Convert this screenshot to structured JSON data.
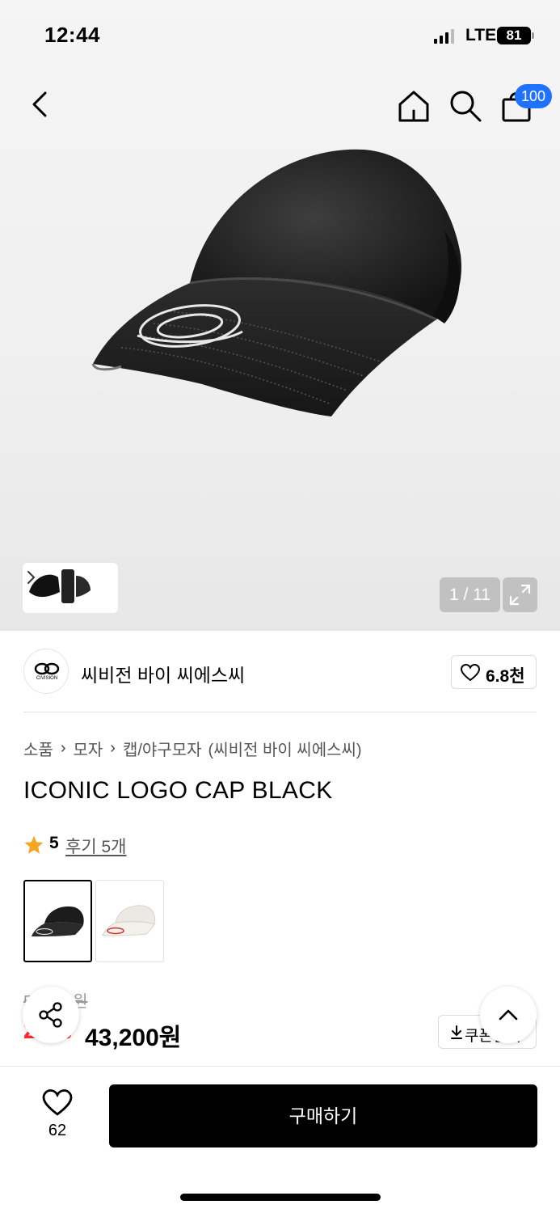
{
  "status_bar": {
    "time": "12:44",
    "network": "LTE",
    "battery": "81"
  },
  "nav": {
    "cart_badge": "100"
  },
  "gallery": {
    "page_counter": "1 / 11"
  },
  "brand": {
    "name": "씨비전 바이 씨에스씨",
    "logo_text": "CIVISION",
    "likes": "6.8천"
  },
  "breadcrumb": {
    "items": [
      "소품",
      "모자",
      "캡/야구모자"
    ],
    "brand": "(씨비전 바이 씨에스씨)"
  },
  "product": {
    "title": "ICONIC LOGO CAP BLACK",
    "rating": "5",
    "review_link": "후기 5개",
    "original_price": "54,000원",
    "discount": "20%",
    "sale_price": "43,200원",
    "coupon_label": "쿠폰받기"
  },
  "bottom_bar": {
    "like_count": "62",
    "buy_label": "구매하기"
  },
  "colors": {
    "accent": "#1f72ff",
    "discount": "#ff2b2b",
    "star": "#f5a623"
  }
}
